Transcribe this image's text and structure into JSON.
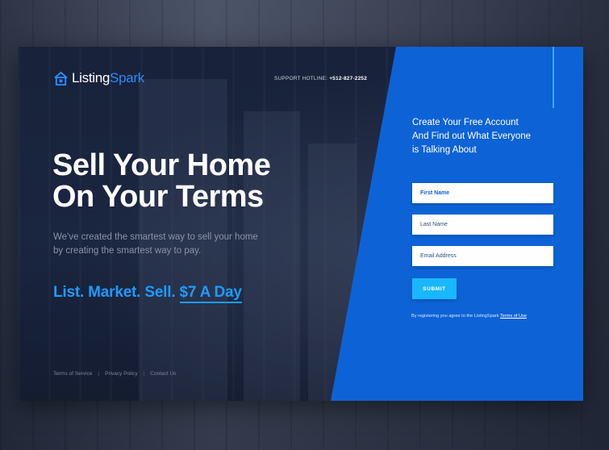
{
  "brand": {
    "name_part1": "Listing",
    "name_part2": "Spark",
    "accent_color": "#2a8cff",
    "icon": "house-icon"
  },
  "header": {
    "hotline_label": "SUPPORT HOTLINE:",
    "hotline_number": "+512-827-2252"
  },
  "hero": {
    "headline_line1": "Sell Your Home",
    "headline_line2": "On Your Terms",
    "subtext_line1": "We've created the smartest way to sell your home",
    "subtext_line2": "by creating the smartest way to pay.",
    "tagline_main": "List. Market. Sell.",
    "tagline_price": "$7 A Day",
    "tagline_color": "#1e9bff"
  },
  "footer": {
    "links": [
      "Terms of Service",
      "Privacy Policy",
      "Contact Us"
    ],
    "separator": "|"
  },
  "signup": {
    "title_line1": "Create Your Free Account",
    "title_line2": "And Find out What Everyone",
    "title_line3": "is Talking About",
    "first_name_placeholder": "First Name",
    "last_name_placeholder": "Last Name",
    "email_placeholder": "Email Address",
    "submit_label": "SUBMIT",
    "terms_text": "By registering you agree to the ListingSpark",
    "terms_link": "Terms of Use",
    "panel_color": "#0d63d6",
    "button_color": "#19b7ff"
  }
}
